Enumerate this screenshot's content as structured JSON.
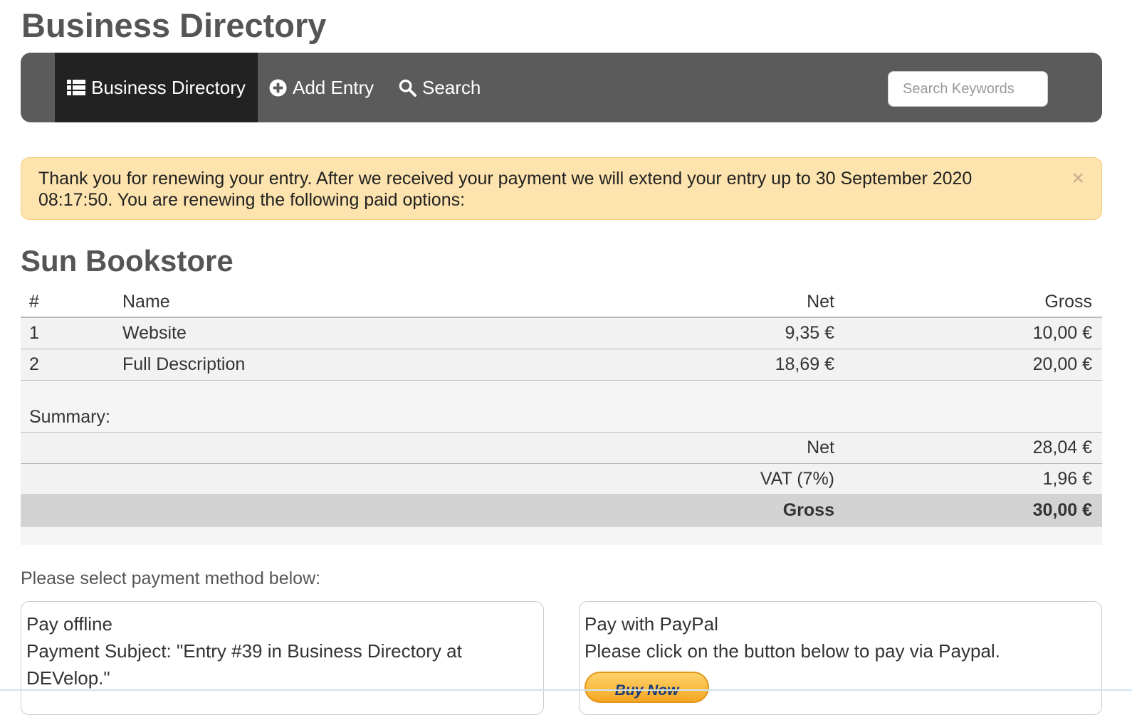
{
  "page": {
    "title": "Business Directory"
  },
  "nav": {
    "items": [
      {
        "label": "Business Directory",
        "icon": "list-icon",
        "active": true
      },
      {
        "label": "Add Entry",
        "icon": "plus-circle-icon"
      },
      {
        "label": "Search",
        "icon": "search-icon"
      }
    ],
    "search_placeholder": "Search Keywords"
  },
  "alert": {
    "message": "Thank you for renewing your entry. After we received your payment we will extend your entry up to 30 September 2020 08:17:50. You are renewing the following paid options:",
    "close": "×"
  },
  "listing": {
    "title": "Sun Bookstore"
  },
  "table": {
    "headers": {
      "num": "#",
      "name": "Name",
      "net": "Net",
      "gross": "Gross"
    },
    "rows": [
      {
        "num": "1",
        "name": "Website",
        "net": "9,35 €",
        "gross": "10,00 €"
      },
      {
        "num": "2",
        "name": "Full Description",
        "net": "18,69 €",
        "gross": "20,00 €"
      }
    ]
  },
  "summary": {
    "label": "Summary:",
    "net_label": "Net",
    "net": "28,04 €",
    "vat_label": "VAT (7%)",
    "vat": "1,96 €",
    "gross_label": "Gross",
    "gross": "30,00 €"
  },
  "payment": {
    "prompt": "Please select payment method below:",
    "offline": {
      "title": "Pay offline",
      "text": "Payment Subject: \"Entry #39 in Business Directory at DEVelop.\""
    },
    "paypal": {
      "title": "Pay with PayPal",
      "text": "Please click on the button below to pay via Paypal.",
      "button": "Buy Now"
    }
  },
  "colors": {
    "navbar": "#5b5b5b",
    "nav_active": "#222222",
    "alert_bg": "#fde3ae",
    "gross_row": "#d3d3d3"
  }
}
